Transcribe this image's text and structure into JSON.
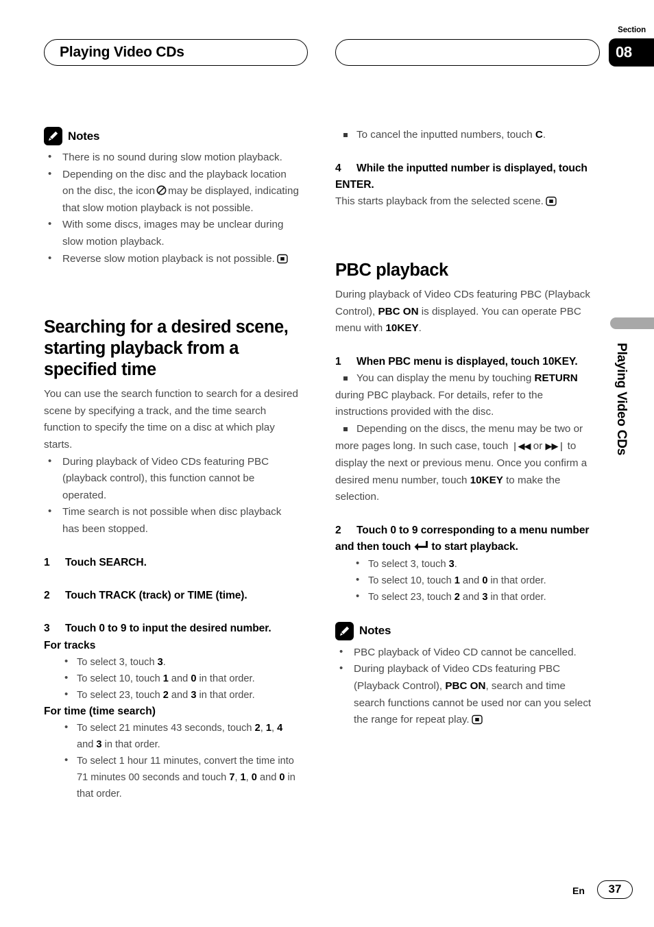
{
  "header": {
    "chapter_title": "Playing Video CDs",
    "section_label": "Section",
    "section_number": "08"
  },
  "side_tab": {
    "label": "Playing Video CDs"
  },
  "footer": {
    "language": "En",
    "page_number": "37"
  },
  "left_column": {
    "notes_heading": "Notes",
    "notes": [
      "There is no sound during slow motion playback.",
      "Depending on the disc and the playback location on the disc, the icon  may be displayed, indicating that slow motion playback is not possible.",
      "With some discs, images may be unclear during slow motion playback.",
      "Reverse slow motion playback is not possible."
    ],
    "notes_part": {
      "n2_a": "Depending on the disc and the playback location on the disc, the icon",
      "n2_b": "may be displayed, indicating that slow motion playback is not possible.",
      "n4": "Reverse slow motion playback is not possi­ble."
    },
    "section_heading": "Searching for a desired scene, starting playback from a specified time",
    "intro": "You can use the search function to search for a desired scene by specifying a track, and the time search function to specify the time on a disc at which play starts.",
    "intro_bullets": [
      "During playback of Video CDs featuring PBC (playback control), this function cannot be operated.",
      "Time search is not possible when disc playback has been stopped."
    ],
    "step1_num": "1",
    "step1": "Touch SEARCH.",
    "step2_num": "2",
    "step2": "Touch TRACK (track) or TIME (time).",
    "step3_num": "3",
    "step3": "Touch 0 to 9 to input the desired number.",
    "subhead_tracks": "For tracks",
    "track_items": [
      {
        "pre": "To select 3, touch ",
        "k1": "3",
        "mid": "",
        "k2": "",
        "post": "."
      },
      {
        "pre": "To select 10, touch ",
        "k1": "1",
        "mid": " and ",
        "k2": "0",
        "post": " in that order."
      },
      {
        "pre": "To select 23, touch ",
        "k1": "2",
        "mid": " and ",
        "k2": "3",
        "post": " in that order."
      }
    ],
    "subhead_time": "For time (time search)",
    "time_item_1": {
      "pre": "To select 21 minutes 43 seconds, touch ",
      "k1": "2",
      "s1": ", ",
      "k2": "1",
      "s2": ", ",
      "k3": "4",
      "s3": " and ",
      "k4": "3",
      "post": " in that order."
    },
    "time_item_2": {
      "pre": "To select 1 hour 11 minutes, convert the time into 71 minutes 00 seconds and touch ",
      "k1": "7",
      "s1": ", ",
      "k2": "1",
      "s2": ", ",
      "k3": "0",
      "s3": " and ",
      "k4": "0",
      "post": " in that order."
    }
  },
  "right_column": {
    "cancel_note_pre": "To cancel the inputted numbers, touch ",
    "cancel_note_key": "C",
    "cancel_note_post": ".",
    "step4_num": "4",
    "step4": "While the inputted number is displayed, touch ENTER.",
    "step4_body": "This starts playback from the selected scene.",
    "pbc_heading": "PBC playback",
    "pbc_intro_1": "During playback of Video CDs featuring PBC (Playback Control), ",
    "pbc_intro_k1": "PBC ON",
    "pbc_intro_2": " is displayed. You can operate PBC menu with ",
    "pbc_intro_k2": "10KEY",
    "pbc_intro_3": ".",
    "step1_num": "1",
    "step1": "When PBC menu is displayed, touch 10KEY.",
    "note_a_1": "You can display the menu by touching ",
    "note_a_k": "RETURN",
    "note_a_2": " during PBC playback. For details, refer to the instructions provided with the disc.",
    "note_b_1": "Depending on the discs, the menu may be two or more pages long. In such case, touch ",
    "note_b_glyph_prev": "❘◀◀",
    "note_b_2": " or ",
    "note_b_glyph_next": "▶▶❘",
    "note_b_3": " to display the next or previous menu. Once you confirm a desired menu number, touch ",
    "note_b_k": "10KEY",
    "note_b_4": " to make the selection.",
    "step2_num": "2",
    "step2_a": "Touch 0 to 9 corresponding to a menu number and then touch",
    "step2_b": "to start playback.",
    "menu_items": [
      {
        "pre": "To select 3, touch ",
        "k1": "3",
        "mid": "",
        "k2": "",
        "post": "."
      },
      {
        "pre": "To select 10, touch ",
        "k1": "1",
        "mid": " and ",
        "k2": "0",
        "post": " in that order."
      },
      {
        "pre": "To select 23, touch ",
        "k1": "2",
        "mid": " and ",
        "k2": "3",
        "post": " in that order."
      }
    ],
    "notes_heading": "Notes",
    "note1": "PBC playback of Video CD cannot be cancelled.",
    "note2_1": "During playback of Video CDs featuring PBC (Playback Control), ",
    "note2_k": "PBC ON",
    "note2_2": ", search and time search functions cannot be used nor can you select the range for repeat play."
  },
  "icons": {
    "notes": "pencil-icon",
    "prohibited": "no-entry-icon",
    "end_mark": "end-of-section-icon",
    "enter_key": "enter-key-icon"
  }
}
